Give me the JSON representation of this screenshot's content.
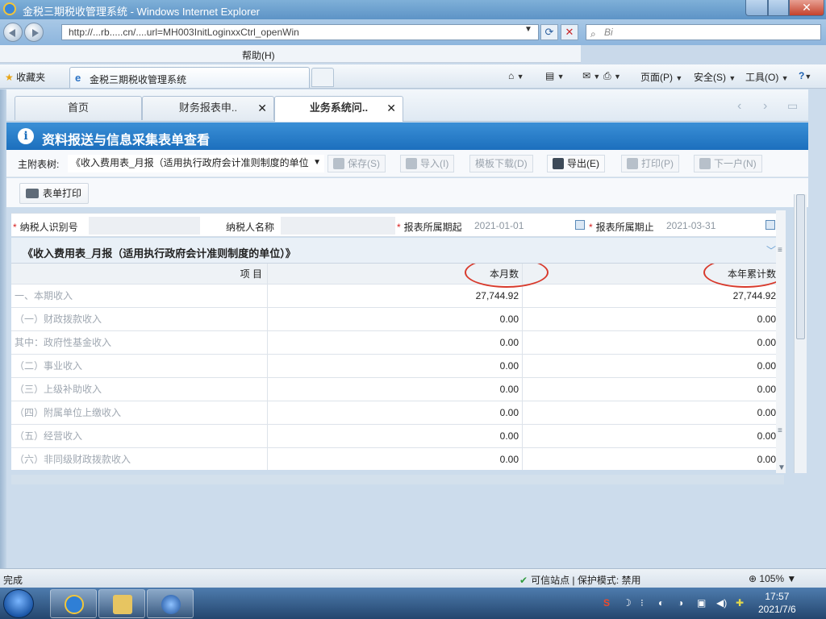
{
  "browser": {
    "title": "金税三期税收管理系统 - Windows Internet Explorer",
    "title_prefix": "ᴇ：",
    "address": "http://...rb.....cn/....url=MH003InitLoginxxCtrl_openWin",
    "search_placeholder": "Bi",
    "menu_help": "帮助(H)",
    "favorites_label": "收藏夹",
    "tab_title": "金税三期税收管理系统",
    "cmd_page": "页面(P)",
    "cmd_safety": "安全(S)",
    "cmd_tools": "工具(O)",
    "status_done": "完成",
    "status_zone": "可信站点 | 保护模式: 禁用",
    "zoom": "105%"
  },
  "app_tabs": [
    {
      "label": "首页",
      "closable": false,
      "active": false
    },
    {
      "label": "财务报表申..",
      "closable": true,
      "active": false
    },
    {
      "label": "业务系统问..",
      "closable": true,
      "active": true
    }
  ],
  "section": {
    "title": "资料报送与信息采集表单查看"
  },
  "toolbar": {
    "form_tree_label": "主附表树:",
    "form_select_value": "《收入费用表_月报（适用执行政府会计准则制度的单位",
    "buttons": [
      {
        "label": "保存(S)",
        "enabled": false
      },
      {
        "label": "导入(I)",
        "enabled": false
      },
      {
        "label": "模板下载(D)",
        "enabled": false
      },
      {
        "label": "导出(E)",
        "enabled": true
      },
      {
        "label": "打印(P)",
        "enabled": false
      },
      {
        "label": "下一户(N)",
        "enabled": false
      }
    ],
    "print_form": "表单打印"
  },
  "taxpayer": {
    "id_label": "纳税人识别号",
    "name_label": "纳税人名称",
    "period_start_label": "报表所属期起",
    "period_start": "2021-01-01",
    "period_end_label": "报表所属期止",
    "period_end": "2021-03-31",
    "required_mark": "*"
  },
  "report": {
    "title": "《收入费用表_月报（适用执行政府会计准则制度的单位）》",
    "columns": [
      "项  目",
      "本月数",
      "本年累计数"
    ],
    "rows": [
      {
        "item": "一、本期收入",
        "month": "27,744.92",
        "ytd": "27,744.92"
      },
      {
        "item": "（一）财政拨款收入",
        "month": "0.00",
        "ytd": "0.00"
      },
      {
        "item": "其中：政府性基金收入",
        "month": "0.00",
        "ytd": "0.00"
      },
      {
        "item": "（二）事业收入",
        "month": "0.00",
        "ytd": "0.00"
      },
      {
        "item": "（三）上级补助收入",
        "month": "0.00",
        "ytd": "0.00"
      },
      {
        "item": "（四）附属单位上缴收入",
        "month": "0.00",
        "ytd": "0.00"
      },
      {
        "item": "（五）经营收入",
        "month": "0.00",
        "ytd": "0.00"
      },
      {
        "item": "（六）非同级财政拨款收入",
        "month": "0.00",
        "ytd": "0.00"
      }
    ]
  },
  "taskbar": {
    "time": "17:57",
    "date": "2021/7/6"
  }
}
